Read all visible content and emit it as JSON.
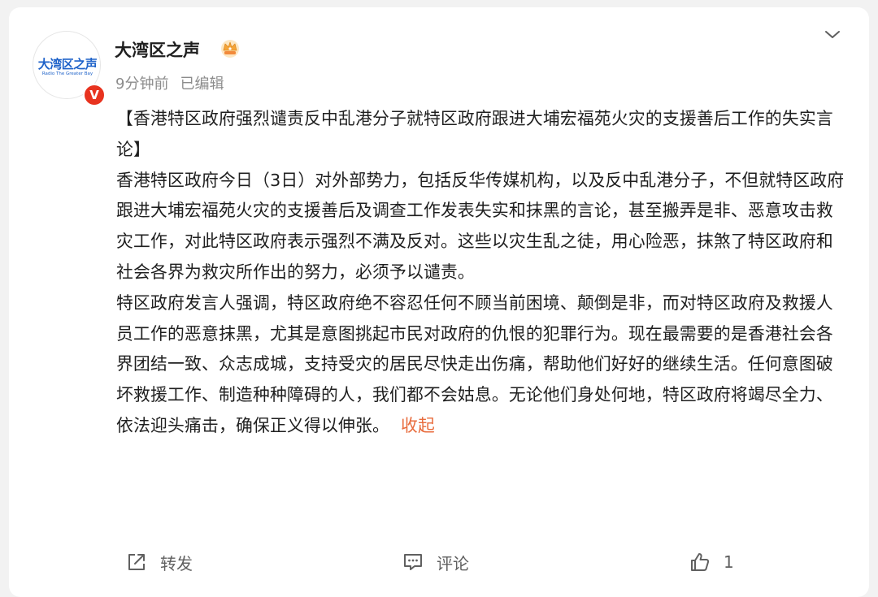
{
  "account": {
    "avatar_title": "大湾区之声",
    "avatar_subtitle": "Radio The Greater Bay",
    "verified_mark": "V",
    "name": "大湾区之声",
    "badge_icon": "crown-icon",
    "time": "9分钟前",
    "status": "已编辑"
  },
  "post": {
    "headline": "【香港特区政府强烈谴责反中乱港分子就特区政府跟进大埔宏福苑火灾的支援善后工作的失实言论】",
    "paragraph1": "香港特区政府今日（3日）对外部势力，包括反华传媒机构，以及反中乱港分子，不但就特区政府跟进大埔宏福苑火灾的支援善后及调查工作发表失实和抹黑的言论，甚至搬弄是非、恶意攻击救灾工作，对此特区政府表示强烈不满及反对。这些以灾生乱之徒，用心险恶，抹煞了特区政府和社会各界为救灾所作出的努力，必须予以谴责。",
    "paragraph2": "特区政府发言人强调，特区政府绝不容忍任何不顾当前困境、颠倒是非，而对特区政府及救援人员工作的恶意抹黑，尤其是意图挑起市民对政府的仇恨的犯罪行为。现在最需要的是香港社会各界团结一致、众志成城，支持受灾的居民尽快走出伤痛，帮助他们好好的继续生活。任何意图破坏救援工作、制造种种障碍的人，我们都不会姑息。无论他们身处何地，特区政府将竭尽全力、依法迎头痛击，确保正义得以伸张。",
    "collapse_label": "收起"
  },
  "actions": {
    "repost_label": "转发",
    "comment_label": "评论",
    "like_count": "1"
  },
  "colors": {
    "brand_blue": "#1e62c9",
    "verified_red": "#e8331f",
    "link_orange": "#e86b3c",
    "text": "#1f1f1f",
    "meta": "#8c8c8c"
  }
}
